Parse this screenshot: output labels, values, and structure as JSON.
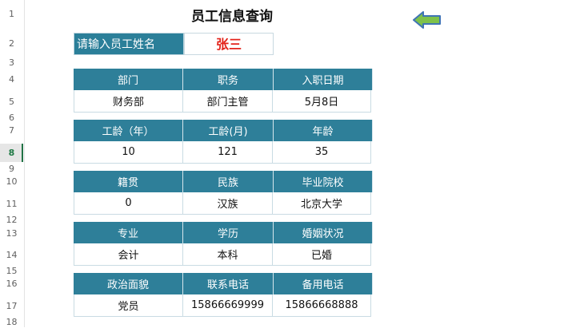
{
  "row_numbers": [
    "1",
    "2",
    "3",
    "4",
    "5",
    "6",
    "7",
    "8",
    "9",
    "10",
    "11",
    "12",
    "13",
    "14",
    "15",
    "16",
    "17",
    "18"
  ],
  "title": "员工信息查询",
  "lookup": {
    "label": "请输入员工姓名",
    "value": "张三"
  },
  "icons": {
    "back_arrow": "left-arrow-icon"
  },
  "colors": {
    "header_bg": "#2e7f99",
    "name_value": "#e3231a",
    "arrow_fill": "#7fc24a",
    "arrow_stroke": "#3f74b5"
  },
  "tables": [
    {
      "headers": [
        "部门",
        "职务",
        "入职日期"
      ],
      "values": [
        "财务部",
        "部门主管",
        "5月8日"
      ]
    },
    {
      "headers": [
        "工龄（年）",
        "工龄(月)",
        "年龄"
      ],
      "values": [
        "10",
        "121",
        "35"
      ]
    },
    {
      "headers": [
        "籍贯",
        "民族",
        "毕业院校"
      ],
      "values": [
        "0",
        "汉族",
        "北京大学"
      ]
    },
    {
      "headers": [
        "专业",
        "学历",
        "婚姻状况"
      ],
      "values": [
        "会计",
        "本科",
        "已婚"
      ]
    },
    {
      "headers": [
        "政治面貌",
        "联系电话",
        "备用电话"
      ],
      "values": [
        "党员",
        "15866669999",
        "15866668888"
      ]
    }
  ]
}
